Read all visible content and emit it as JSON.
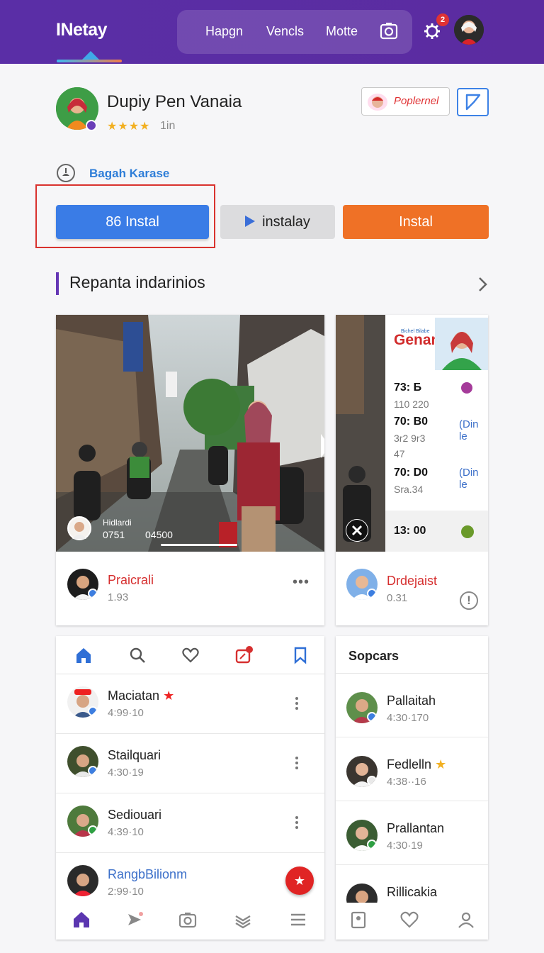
{
  "topbar": {
    "brand": "INetay",
    "nav": [
      "Hapgn",
      "Vencls",
      "Motte"
    ],
    "notification_count": "2"
  },
  "profile": {
    "name": "Dupiy Pen Vanaia",
    "stars": "★★★★",
    "stars_count": "1in",
    "follow_label": "Poplernel",
    "location": "Bagah Karase"
  },
  "actions": {
    "primary": "86 Instal",
    "secondary": "instalay",
    "tertiary": "Instal"
  },
  "section": {
    "title": "Repanta indarinios"
  },
  "feature_card": {
    "photo_caption_1": "Hidlardi",
    "photo_caption_2": "0751",
    "photo_caption_3": "04500",
    "author": "Praicrali",
    "meta": "1.93",
    "more": "•••"
  },
  "stats_card": {
    "headline": "Genani",
    "headline_small": "Bichel Bilabe",
    "entries": [
      {
        "big": "73: Б",
        "small": "110 220"
      },
      {
        "big": "70: B0",
        "small": "3r2 9r3",
        "small2": "47",
        "link": "(Din le"
      },
      {
        "big": "70: D0",
        "small": "Sra.34",
        "link": "(Din le"
      },
      {
        "big": "13: 00"
      }
    ],
    "author": "Drdejaist",
    "meta": "0.31",
    "info": "!"
  },
  "list_card": {
    "rows": [
      {
        "name": "Maciatan",
        "time": "4:99·10"
      },
      {
        "name": "Stailquari",
        "time": "4:30·19"
      },
      {
        "name": "Sediouari",
        "time": "4:39·10"
      },
      {
        "name": "RangbBilionm",
        "time": "2:99·10"
      }
    ],
    "fab": "★"
  },
  "side_card": {
    "title": "Sopcars",
    "rows": [
      {
        "name": "Pallaitah",
        "time": "4:30·170"
      },
      {
        "name": "Fedlelln",
        "time": "4:38··16"
      },
      {
        "name": "Prallantan",
        "time": "4:30·19"
      },
      {
        "name": "Rillicakia",
        "time": ""
      }
    ]
  },
  "colors": {
    "topbar": "#5a2ea6",
    "primary_button": "#3a7ce6",
    "orange_button": "#ef7126",
    "accent_red": "#d62f2f",
    "link_blue": "#2f7ed8"
  }
}
